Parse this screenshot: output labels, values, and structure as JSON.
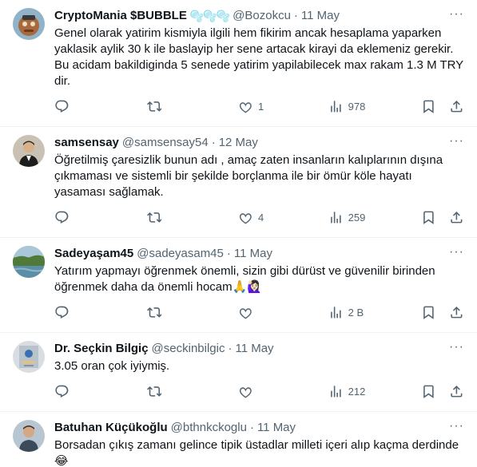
{
  "tweets": [
    {
      "name": "CryptoMania $BUBBLE",
      "badge": "🫧🫧🫧",
      "handle": "@Bozokcu",
      "date": "11 May",
      "text": "Genel olarak yatirim kismiyla ilgili hem fikirim ancak hesaplama yaparken yaklasik aylik 30 k ile baslayip her sene artacak kirayi da eklemeniz gerekir. Bu acidam bakildiginda 5 senede yatirim yapilabilecek max rakam 1.3 M TRY dir.",
      "replies": "",
      "retweets": "",
      "likes": "1",
      "views": "978"
    },
    {
      "name": "samsensay",
      "badge": "",
      "handle": "@samsensay54",
      "date": "12 May",
      "text": "Öğretilmiş çaresizlik bunun adı , amaç zaten insanların kalıplarının dışına çıkmaması ve sistemli bir şekilde borçlanma ile bir ömür köle hayatı yasaması sağlamak.",
      "replies": "",
      "retweets": "",
      "likes": "4",
      "views": "259"
    },
    {
      "name": "Sadeyaşam45",
      "badge": "",
      "handle": "@sadeyasam45",
      "date": "11 May",
      "text": "Yatırım yapmayı öğrenmek önemli, sizin gibi dürüst ve güvenilir birinden öğrenmek daha da önemli hocam🙏🙋🏻‍♀️",
      "replies": "",
      "retweets": "",
      "likes": "",
      "views": "2 B"
    },
    {
      "name": "Dr. Seçkin Bilgiç",
      "badge": "",
      "handle": "@seckinbilgic",
      "date": "11 May",
      "text": "3.05 oran çok iyiymiş.",
      "replies": "",
      "retweets": "",
      "likes": "",
      "views": "212"
    },
    {
      "name": "Batuhan Küçükoğlu",
      "badge": "",
      "handle": "@bthnkckoglu",
      "date": "11 May",
      "text": "Borsadan çıkış zamanı gelince tipik üstadlar milleti içeri alıp kaçma derdinde😂",
      "replies": "",
      "retweets": "",
      "likes": "",
      "views": ""
    }
  ],
  "separator": "·",
  "more_label": "···",
  "colors": {
    "text": "#0f1419",
    "secondary": "#536471",
    "border": "#eff3f4"
  },
  "icons": {
    "reply": "reply-icon",
    "retweet": "retweet-icon",
    "like": "heart-icon",
    "views": "views-icon",
    "bookmark": "bookmark-icon",
    "share": "share-icon",
    "more": "more-icon"
  }
}
